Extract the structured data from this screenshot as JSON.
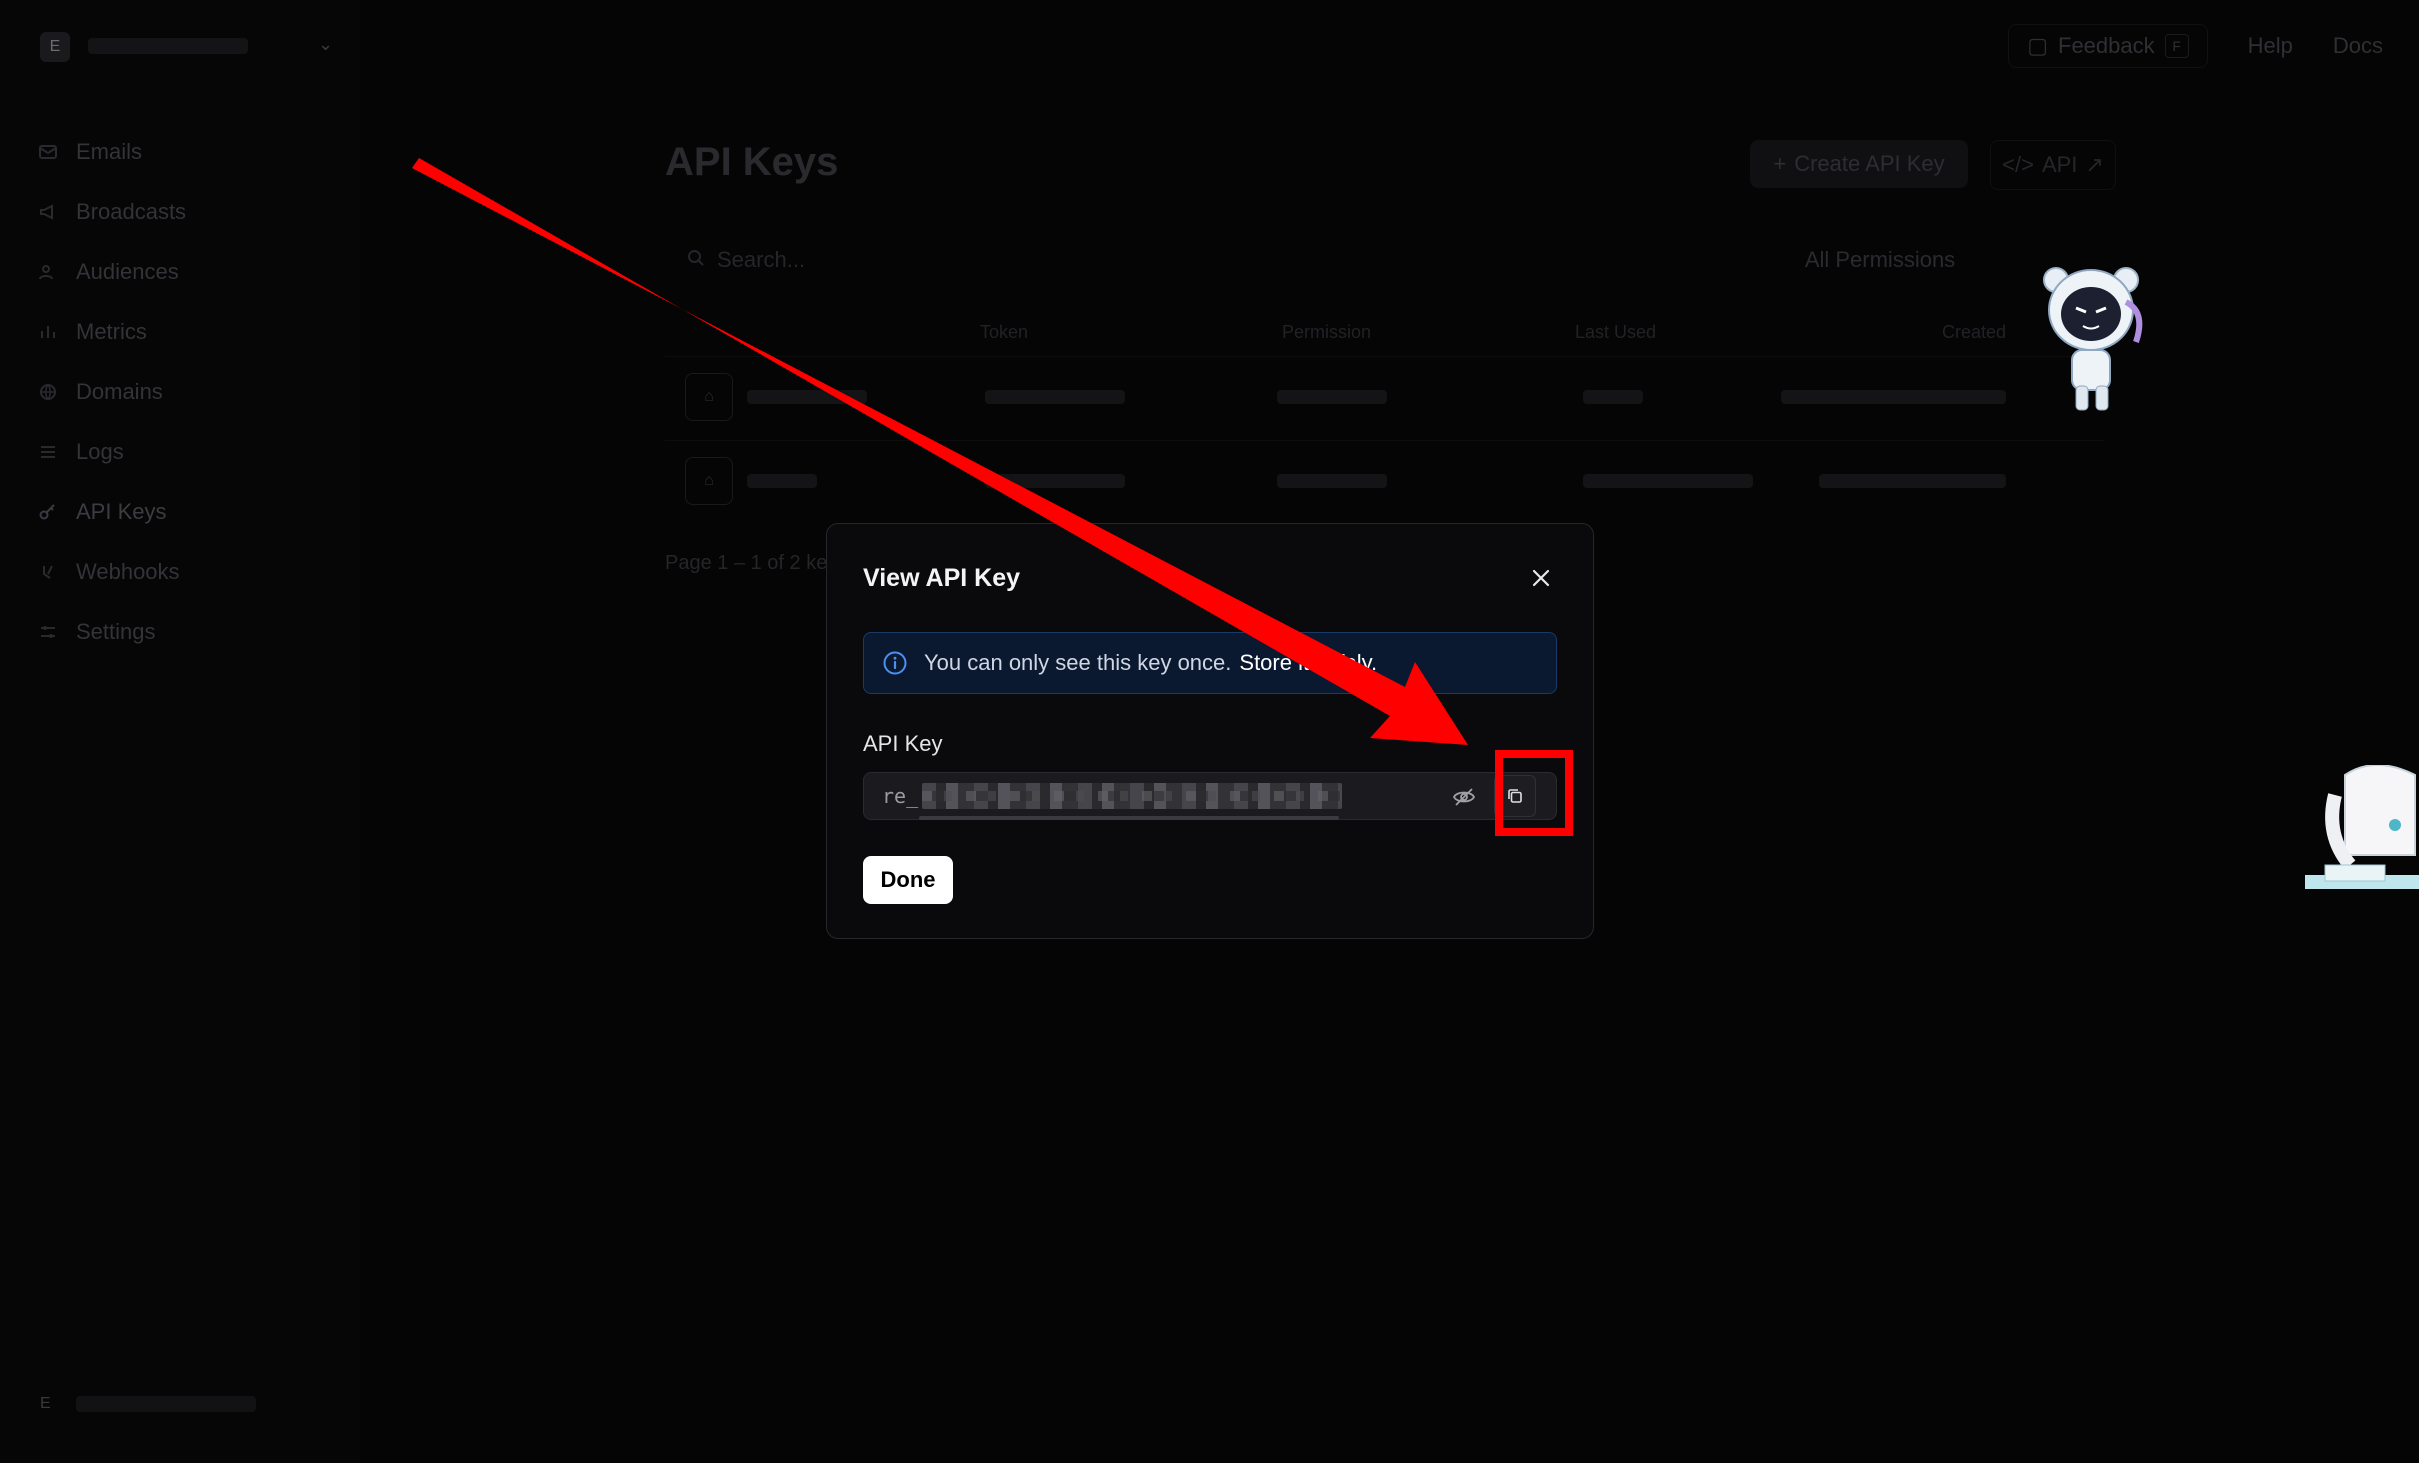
{
  "workspace": {
    "logo_letter": "E"
  },
  "topbar": {
    "feedback": "Feedback",
    "feedback_key": "F",
    "help": "Help",
    "docs": "Docs"
  },
  "sidebar": {
    "items": [
      {
        "label": "Emails",
        "icon": "mail-icon"
      },
      {
        "label": "Broadcasts",
        "icon": "megaphone-icon"
      },
      {
        "label": "Audiences",
        "icon": "users-icon"
      },
      {
        "label": "Metrics",
        "icon": "bar-chart-icon"
      },
      {
        "label": "Domains",
        "icon": "globe-icon"
      },
      {
        "label": "Logs",
        "icon": "list-icon"
      },
      {
        "label": "API Keys",
        "icon": "key-icon",
        "active": true
      },
      {
        "label": "Webhooks",
        "icon": "webhook-icon"
      },
      {
        "label": "Settings",
        "icon": "sliders-icon"
      }
    ],
    "user_initial": "E"
  },
  "main": {
    "title": "API Keys",
    "create_button": "Create API Key",
    "api_button": "API",
    "search_placeholder": "Search...",
    "permission_filter": "All Permissions",
    "columns": [
      "Token",
      "Permission",
      "Last Used",
      "Created"
    ],
    "pager": "Page 1 – 1 of 2 keys"
  },
  "modal": {
    "title": "View API Key",
    "alert_text": "You can only see this key once.",
    "alert_emphasis": "Store it safely.",
    "field_label": "API Key",
    "key_prefix": "re_",
    "done_label": "Done"
  },
  "colors": {
    "annotation": "#ff0000",
    "alert_bg": "#0a1830",
    "alert_border": "#1b3b66"
  }
}
